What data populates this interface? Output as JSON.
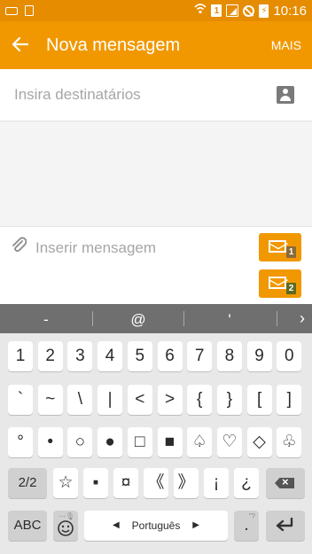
{
  "status_bar": {
    "time": "10:16",
    "sim_label": "1",
    "left_icons": [
      "keyboard-icon",
      "document-icon"
    ],
    "right_icons": [
      "wifi-call-icon",
      "sim-icon",
      "signal-icon",
      "blocked-icon",
      "battery-charging-icon"
    ]
  },
  "app_bar": {
    "title": "Nova mensagem",
    "more_label": "MAIS",
    "back_icon": "arrow-left-icon"
  },
  "recipients": {
    "placeholder": "Insira destinatários",
    "icon": "contact-icon"
  },
  "compose": {
    "placeholder": "Inserir mensagem",
    "attach_icon": "paperclip-icon",
    "send_buttons": [
      {
        "sim": "1",
        "icon": "send-message-icon"
      },
      {
        "sim": "2",
        "icon": "send-message-icon"
      }
    ]
  },
  "keyboard": {
    "suggestions": [
      "-",
      "@",
      "'"
    ],
    "suggestion_arrow": "›",
    "row1": [
      "1",
      "2",
      "3",
      "4",
      "5",
      "6",
      "7",
      "8",
      "9",
      "0"
    ],
    "row2": [
      "`",
      "~",
      "\\",
      "|",
      "<",
      ">",
      "{",
      "}",
      "[",
      "]"
    ],
    "row3": [
      "°",
      "•",
      "○",
      "●",
      "□",
      "■",
      "♤",
      "♡",
      "◇",
      "♧"
    ],
    "row4": [
      "☆",
      "▪",
      "¤",
      "《",
      "》",
      "¡",
      "¿"
    ],
    "page_label": "2/2",
    "abc_label": "ABC",
    "language_label": "Português",
    "period_label": ".",
    "emoji_icon": "emoji-icon",
    "delete_icon": "backspace-icon",
    "enter_icon": "enter-icon",
    "colors": {
      "accent": "#f19800",
      "status_bar": "#e58c00",
      "suggestion_bar": "#6f6f6f"
    }
  }
}
